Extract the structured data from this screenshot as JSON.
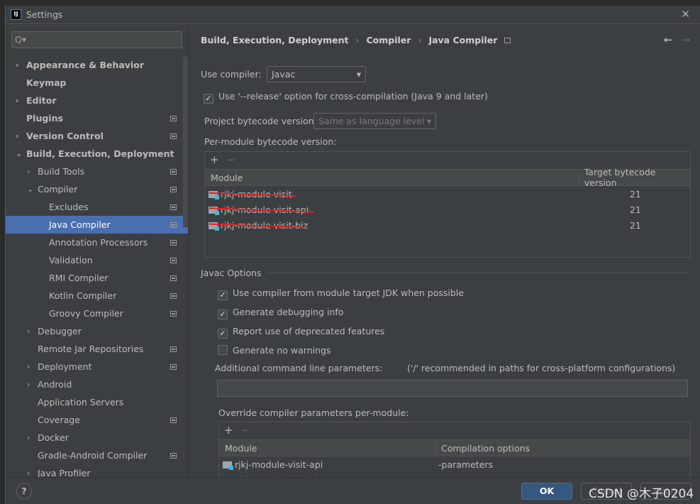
{
  "window": {
    "title": "Settings"
  },
  "search": {
    "placeholder": "Q▾"
  },
  "tree": [
    {
      "label": "Appearance & Behavior",
      "level": 0,
      "arrow": "›",
      "bold": true,
      "gear": false
    },
    {
      "label": "Keymap",
      "level": 0,
      "arrow": "",
      "bold": true,
      "gear": false
    },
    {
      "label": "Editor",
      "level": 0,
      "arrow": "›",
      "bold": true,
      "gear": false
    },
    {
      "label": "Plugins",
      "level": 0,
      "arrow": "",
      "bold": true,
      "gear": true
    },
    {
      "label": "Version Control",
      "level": 0,
      "arrow": "›",
      "bold": true,
      "gear": true
    },
    {
      "label": "Build, Execution, Deployment",
      "level": 0,
      "arrow": "⌄",
      "bold": true,
      "gear": false
    },
    {
      "label": "Build Tools",
      "level": 1,
      "arrow": "›",
      "bold": false,
      "gear": true
    },
    {
      "label": "Compiler",
      "level": 1,
      "arrow": "⌄",
      "bold": false,
      "gear": true
    },
    {
      "label": "Excludes",
      "level": 2,
      "arrow": "",
      "bold": false,
      "gear": true
    },
    {
      "label": "Java Compiler",
      "level": 2,
      "arrow": "",
      "bold": false,
      "gear": true,
      "selected": true
    },
    {
      "label": "Annotation Processors",
      "level": 2,
      "arrow": "",
      "bold": false,
      "gear": true
    },
    {
      "label": "Validation",
      "level": 2,
      "arrow": "",
      "bold": false,
      "gear": true
    },
    {
      "label": "RMI Compiler",
      "level": 2,
      "arrow": "",
      "bold": false,
      "gear": true
    },
    {
      "label": "Kotlin Compiler",
      "level": 2,
      "arrow": "",
      "bold": false,
      "gear": true
    },
    {
      "label": "Groovy Compiler",
      "level": 2,
      "arrow": "",
      "bold": false,
      "gear": true
    },
    {
      "label": "Debugger",
      "level": 1,
      "arrow": "›",
      "bold": false,
      "gear": false
    },
    {
      "label": "Remote Jar Repositories",
      "level": 1,
      "arrow": "",
      "bold": false,
      "gear": true
    },
    {
      "label": "Deployment",
      "level": 1,
      "arrow": "›",
      "bold": false,
      "gear": true
    },
    {
      "label": "Android",
      "level": 1,
      "arrow": "›",
      "bold": false,
      "gear": false
    },
    {
      "label": "Application Servers",
      "level": 1,
      "arrow": "",
      "bold": false,
      "gear": false
    },
    {
      "label": "Coverage",
      "level": 1,
      "arrow": "",
      "bold": false,
      "gear": true
    },
    {
      "label": "Docker",
      "level": 1,
      "arrow": "›",
      "bold": false,
      "gear": false
    },
    {
      "label": "Gradle-Android Compiler",
      "level": 1,
      "arrow": "",
      "bold": false,
      "gear": true
    },
    {
      "label": "Java Profiler",
      "level": 1,
      "arrow": "›",
      "bold": false,
      "gear": false
    }
  ],
  "breadcrumb": [
    "Build, Execution, Deployment",
    "Compiler",
    "Java Compiler"
  ],
  "main": {
    "use_compiler_label": "Use compiler:",
    "use_compiler_value": "Javac",
    "release_option": {
      "label": "Use '--release' option for cross-compilation (Java 9 and later)",
      "checked": true
    },
    "project_bytecode_label": "Project bytecode version:",
    "project_bytecode_value": "Same as language level",
    "per_module_label": "Per-module bytecode version:",
    "module_table": {
      "headers": [
        "Module",
        "Target bytecode version"
      ],
      "rows": [
        {
          "module": "rjkj-module-visit",
          "version": "21"
        },
        {
          "module": "rjkj-module-visit-api",
          "version": "21"
        },
        {
          "module": "rjkj-module-visit-biz",
          "version": "21"
        }
      ]
    },
    "javac_options_label": "Javac Options",
    "options": [
      {
        "label": "Use compiler from module target JDK when possible",
        "checked": true
      },
      {
        "label": "Generate debugging info",
        "checked": true
      },
      {
        "label": "Report use of deprecated features",
        "checked": true
      },
      {
        "label": "Generate no warnings",
        "checked": false
      }
    ],
    "additional_params_label": "Additional command line parameters:",
    "additional_params_hint": "('/' recommended in paths for cross-platform configurations)",
    "additional_params_value": "",
    "override_label": "Override compiler parameters per-module:",
    "override_table": {
      "headers": [
        "Module",
        "Compilation options"
      ],
      "rows": [
        {
          "module": "rjkj-module-visit-api",
          "options": "-parameters"
        },
        {
          "module": "rjkj-module-visit-biz",
          "options": "-parameters"
        }
      ]
    }
  },
  "footer": {
    "help": "?",
    "ok": "OK",
    "cancel": "Cancel",
    "apply": "Apply"
  },
  "watermark": "CSDN @木子0204"
}
